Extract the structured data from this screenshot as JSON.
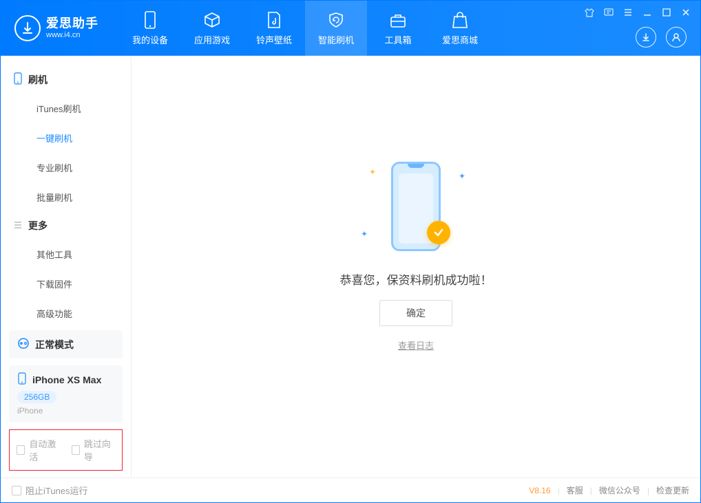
{
  "app": {
    "title": "爱思助手",
    "subtitle": "www.i4.cn"
  },
  "tabs": [
    {
      "label": "我的设备"
    },
    {
      "label": "应用游戏"
    },
    {
      "label": "铃声壁纸"
    },
    {
      "label": "智能刷机"
    },
    {
      "label": "工具箱"
    },
    {
      "label": "爱思商城"
    }
  ],
  "sidebar": {
    "section1": {
      "title": "刷机",
      "items": [
        "iTunes刷机",
        "一键刷机",
        "专业刷机",
        "批量刷机"
      ]
    },
    "section2": {
      "title": "更多",
      "items": [
        "其他工具",
        "下载固件",
        "高级功能"
      ]
    },
    "mode_label": "正常模式",
    "device": {
      "name": "iPhone XS Max",
      "capacity": "256GB",
      "type": "iPhone"
    },
    "checkboxes": {
      "auto_activate": "自动激活",
      "skip_guide": "跳过向导"
    }
  },
  "main": {
    "success_message": "恭喜您，保资料刷机成功啦！",
    "ok_button": "确定",
    "view_log": "查看日志"
  },
  "footer": {
    "block_itunes": "阻止iTunes运行",
    "version": "V8.16",
    "links": [
      "客服",
      "微信公众号",
      "检查更新"
    ]
  }
}
